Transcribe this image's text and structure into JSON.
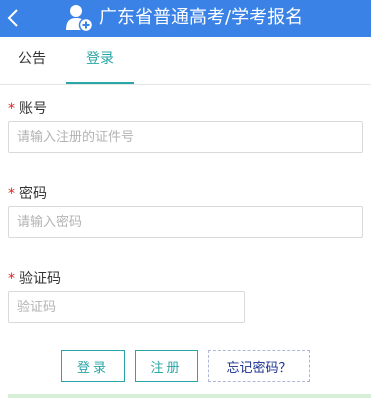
{
  "header": {
    "title": "广东省普通高考/学考报名",
    "back_icon": "chevron-left-icon",
    "app_icon": "user-add-icon",
    "background": "#3b82e6"
  },
  "tabs": [
    {
      "label": "公告",
      "active": false
    },
    {
      "label": "登录",
      "active": true
    }
  ],
  "form": {
    "required_mark": "*",
    "account": {
      "label": "账号",
      "placeholder": "请输入注册的证件号",
      "value": ""
    },
    "password": {
      "label": "密码",
      "placeholder": "请输入密码",
      "value": ""
    },
    "captcha": {
      "label": "验证码",
      "placeholder": "验证码",
      "value": ""
    }
  },
  "buttons": {
    "login": "登录",
    "register": "注册",
    "forgot": "忘记密码？"
  },
  "colors": {
    "accent": "#2aa6a6",
    "required": "#e02020",
    "forgot_text": "#1a2f8f"
  }
}
